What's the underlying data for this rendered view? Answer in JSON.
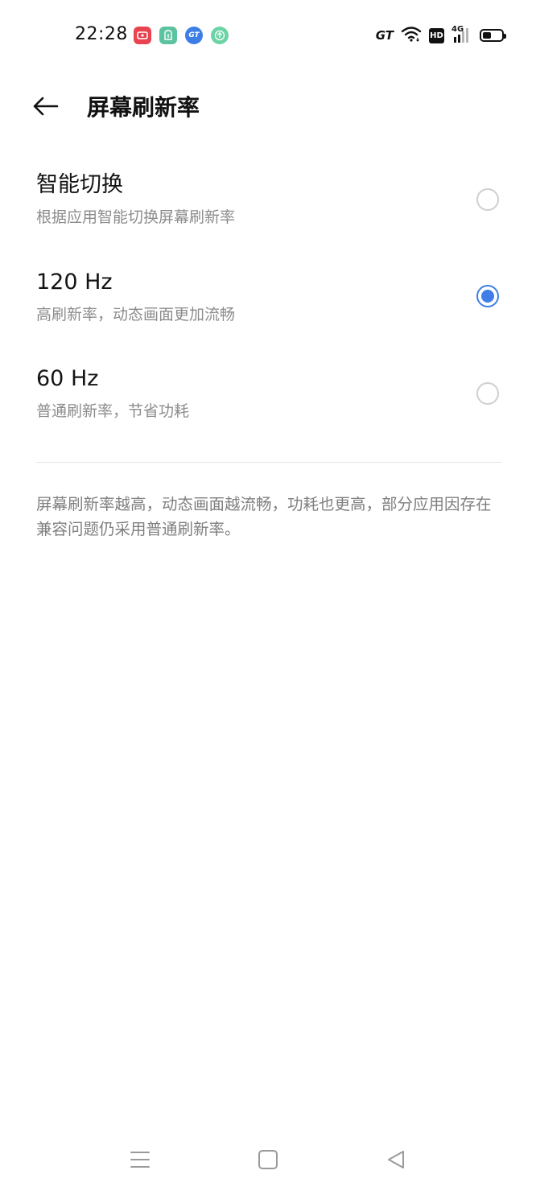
{
  "status_bar": {
    "time": "22:28",
    "notification_icons": [
      {
        "name": "screen-record-app-icon",
        "color": "#e8434f",
        "glyph": "▣"
      },
      {
        "name": "shopping-app-icon",
        "color": "#5cc3a0",
        "glyph": "⊞"
      },
      {
        "name": "gt-mode-app-icon",
        "color": "#3c7ee6",
        "glyph": "GT"
      },
      {
        "name": "upload-app-icon",
        "color": "#6cd3a5",
        "glyph": "↑"
      }
    ],
    "gt_label": "GT",
    "hd_label": "HD",
    "network_label": "4G",
    "battery_level": 0.45
  },
  "header": {
    "title": "屏幕刷新率"
  },
  "options": [
    {
      "title": "智能切换",
      "description": "根据应用智能切换屏幕刷新率",
      "selected": false
    },
    {
      "title": "120 Hz",
      "description": "高刷新率，动态画面更加流畅",
      "selected": true
    },
    {
      "title": "60 Hz",
      "description": "普通刷新率，节省功耗",
      "selected": false
    }
  ],
  "footnote": "屏幕刷新率越高，动态画面越流畅，功耗也更高，部分应用因存在兼容问题仍采用普通刷新率。",
  "colors": {
    "accent": "#3f7ee8",
    "secondary_text": "#8c8c8c"
  }
}
